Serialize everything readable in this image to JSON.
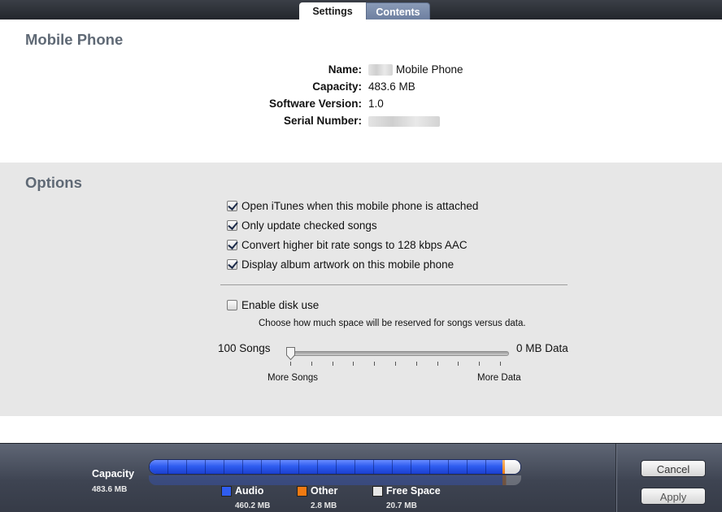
{
  "tabs": {
    "settings": "Settings",
    "contents": "Contents"
  },
  "device": {
    "heading": "Mobile Phone",
    "name_label": "Name:",
    "name_value": "Mobile Phone",
    "capacity_label": "Capacity:",
    "capacity_value": "483.6 MB",
    "software_label": "Software Version:",
    "software_value": "1.0",
    "serial_label": "Serial Number:"
  },
  "options": {
    "heading": "Options",
    "items": [
      {
        "label": "Open iTunes when this mobile phone is attached",
        "checked": true
      },
      {
        "label": "Only update checked songs",
        "checked": true
      },
      {
        "label": "Convert higher bit rate songs to 128 kbps AAC",
        "checked": true
      },
      {
        "label": "Display album artwork on this mobile phone",
        "checked": true
      }
    ],
    "disk_use": {
      "label": "Enable disk use",
      "checked": false
    },
    "disk_caption": "Choose how much space will be reserved for songs versus data.",
    "slider": {
      "left_label": "100 Songs",
      "right_label": "0 MB Data",
      "min_caption": "More Songs",
      "max_caption": "More Data",
      "position": 0
    }
  },
  "storage": {
    "capacity_label": "Capacity",
    "capacity_value": "483.6 MB",
    "audio_label": "Audio",
    "audio_value": "460.2 MB",
    "audio_mb": 460.2,
    "other_label": "Other",
    "other_value": "2.8 MB",
    "other_mb": 2.8,
    "free_label": "Free Space",
    "free_value": "20.7 MB",
    "free_mb": 20.7,
    "colors": {
      "audio": "#2f5df0",
      "other": "#f07a12",
      "free": "#e6e6e6"
    }
  },
  "buttons": {
    "cancel": "Cancel",
    "apply": "Apply"
  }
}
